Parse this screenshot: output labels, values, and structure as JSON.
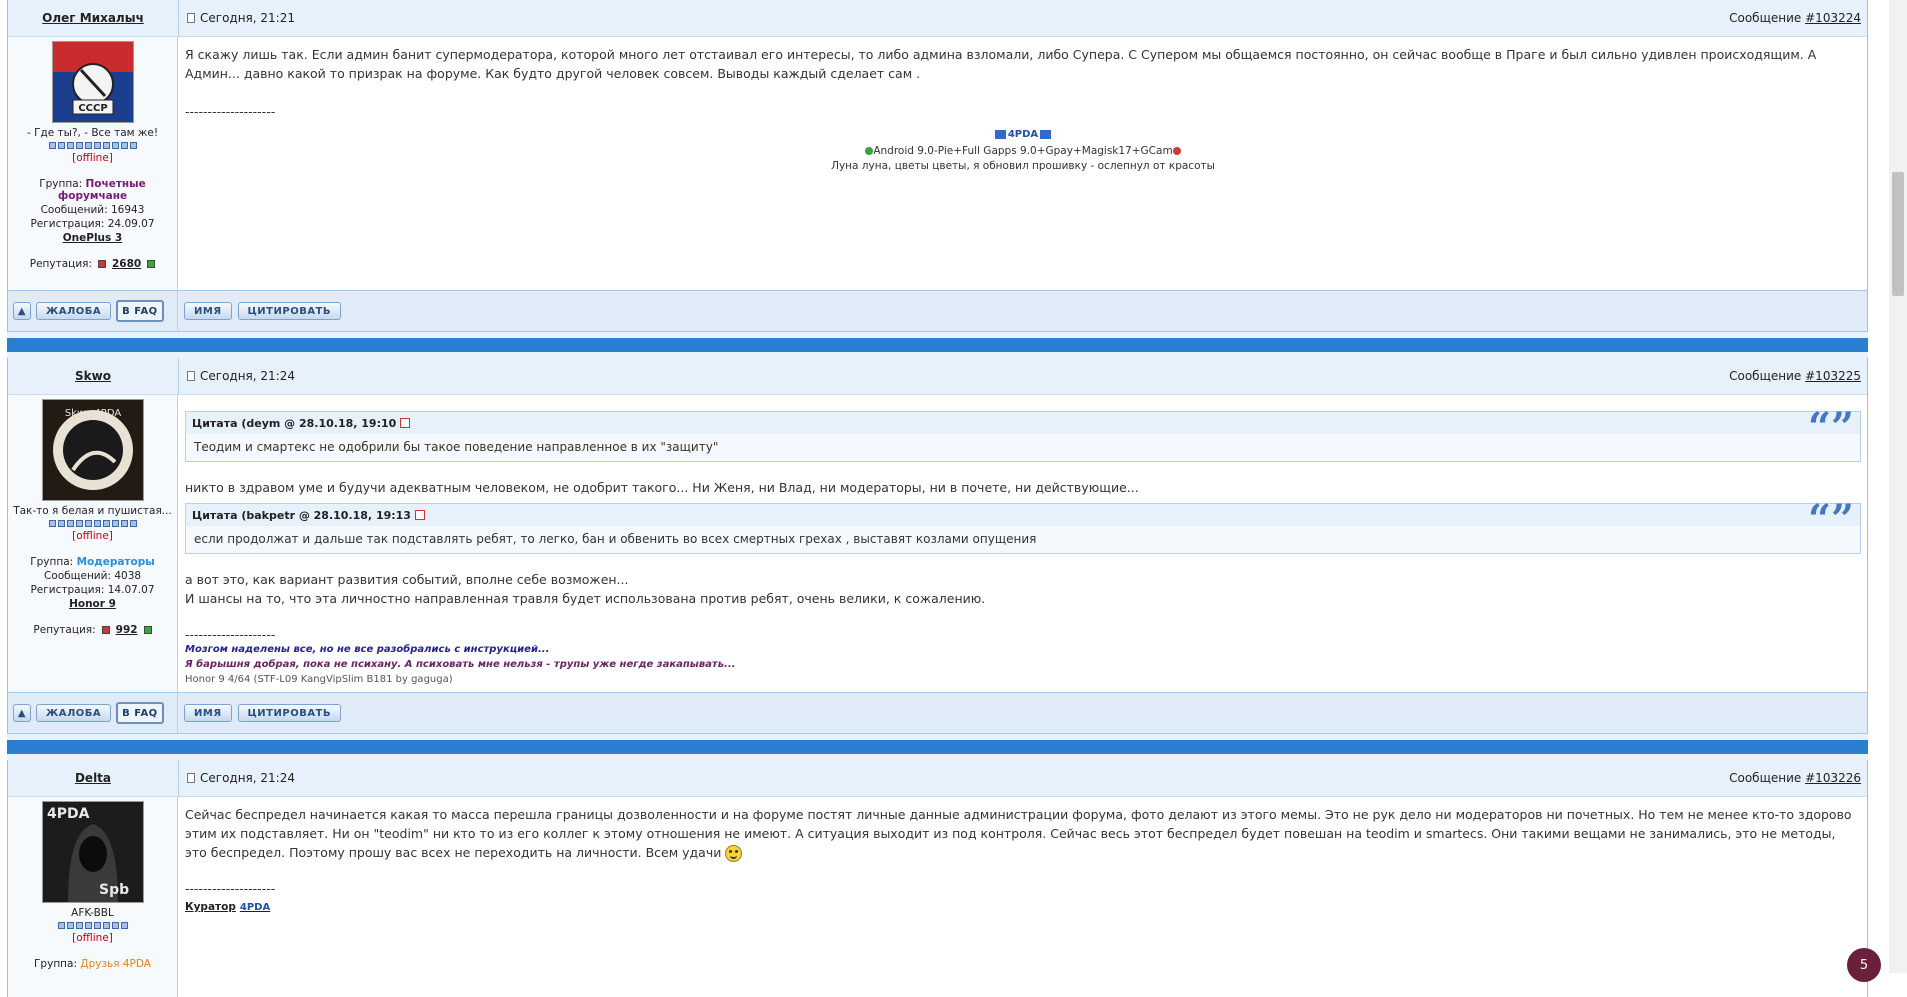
{
  "posts": [
    {
      "author": "Олег Михалыч",
      "date": "Сегодня, 21:21",
      "msg_label": "Сообщение",
      "msg_num": "#103224",
      "status": "- Где ты?, - Все там же!",
      "offline": "[offline]",
      "group_label": "Группа:",
      "group": "Почетные форумчане",
      "messages": "Сообщений: 16943",
      "registered": "Регистрация: 24.09.07",
      "device": "OnePlus 3",
      "rep_label": "Репутация:",
      "rep": "2680",
      "text": "Я скажу лишь так. Если админ банит супермодератора, которой много лет отстаивал его интересы, то либо админа взломали, либо Супера. С Супером мы общаемся постоянно, он сейчас вообще в Праге и был сильно удивлен происходящим. А Админ... давно какой то призрак на форуме. Как будто другой человек совсем. Выводы каждый сделает сам .",
      "divider": "--------------------",
      "sig_badge": "4PDA",
      "sig_line1": "Android 9.0-Pie+Full Gapps 9.0+Gpay+Magisk17+GCam",
      "sig_line2": "Луна луна, цветы цветы, я обновил прошивку - ослепнул от красоты"
    },
    {
      "author": "Skwo",
      "date": "Сегодня, 21:24",
      "msg_label": "Сообщение",
      "msg_num": "#103225",
      "status": "Так-то я белая и пушистая...",
      "offline": "[offline]",
      "group_label": "Группа:",
      "group": "Модераторы",
      "messages": "Сообщений: 4038",
      "registered": "Регистрация: 14.07.07",
      "device": "Honor 9",
      "rep_label": "Репутация:",
      "rep": "992",
      "quote1_title": "Цитата (deym @ 28.10.18, 19:10",
      "quote1_text": "Теодим и смартекс не одобрили бы такое поведение направленное в их \"защиту\"",
      "text1": "никто в здравом уме и будучи адекватным человеком, не одобрит такого... Ни Женя, ни Влад, ни модераторы, ни в почете, ни действующие...",
      "quote2_title": "Цитата (bakpetr @ 28.10.18, 19:13",
      "quote2_text": "если продолжат и дальше так подставлять ребят, то легко, бан и обвенить во всех смертных грехах , выставят козлами опущения",
      "text2": "а вот это, как вариант развития событий, вполне себе возможен...",
      "text3": "И шансы на то, что эта личностно направленная травля будет использована против ребят, очень велики, к сожалению.",
      "divider": "--------------------",
      "sig1": "Мозгом наделены все, но не все разобрались с инструкцией...",
      "sig2": "Я барышня добрая, пока не психану. А психовать мне нельзя - трупы уже негде закапывать...",
      "sig3": "Honor 9 4/64 (STF-L09 KangVipSlim B181 by gaguga)"
    },
    {
      "author": "Delta",
      "date": "Сегодня, 21:24",
      "msg_label": "Сообщение",
      "msg_num": "#103226",
      "status": "AFK-BBL",
      "offline": "[offline]",
      "group_label": "Группа:",
      "group": "Друзья 4PDA",
      "text": "Сейчас беспредел начинается какая то масса перешла границы дозволенности и на форуме постят личные данные администрации форума, фото делают из этого мемы. Это не рук дело ни модераторов ни почетных. Но тем не менее кто-то здорово этим их подставляет. Ни он \"teodim\" ни кто то из его коллег к этому отношения не имеют. А ситуация выходит из под контроля. Сейчас весь этот беспредел будет повешан на teodim и smartecs. Они такими вещами не занимались, это не методы, это беспредел. Поэтому прошу вас всех не переходить на личности. Всем удачи",
      "divider": "--------------------",
      "curator": "Куратор",
      "curator_badge": "4PDA"
    }
  ],
  "buttons": {
    "complain": "ЖАЛОБА",
    "faq": "В FAQ",
    "name": "ИМЯ",
    "quote": "ЦИТИРОВАТЬ"
  },
  "page_badge": "5"
}
